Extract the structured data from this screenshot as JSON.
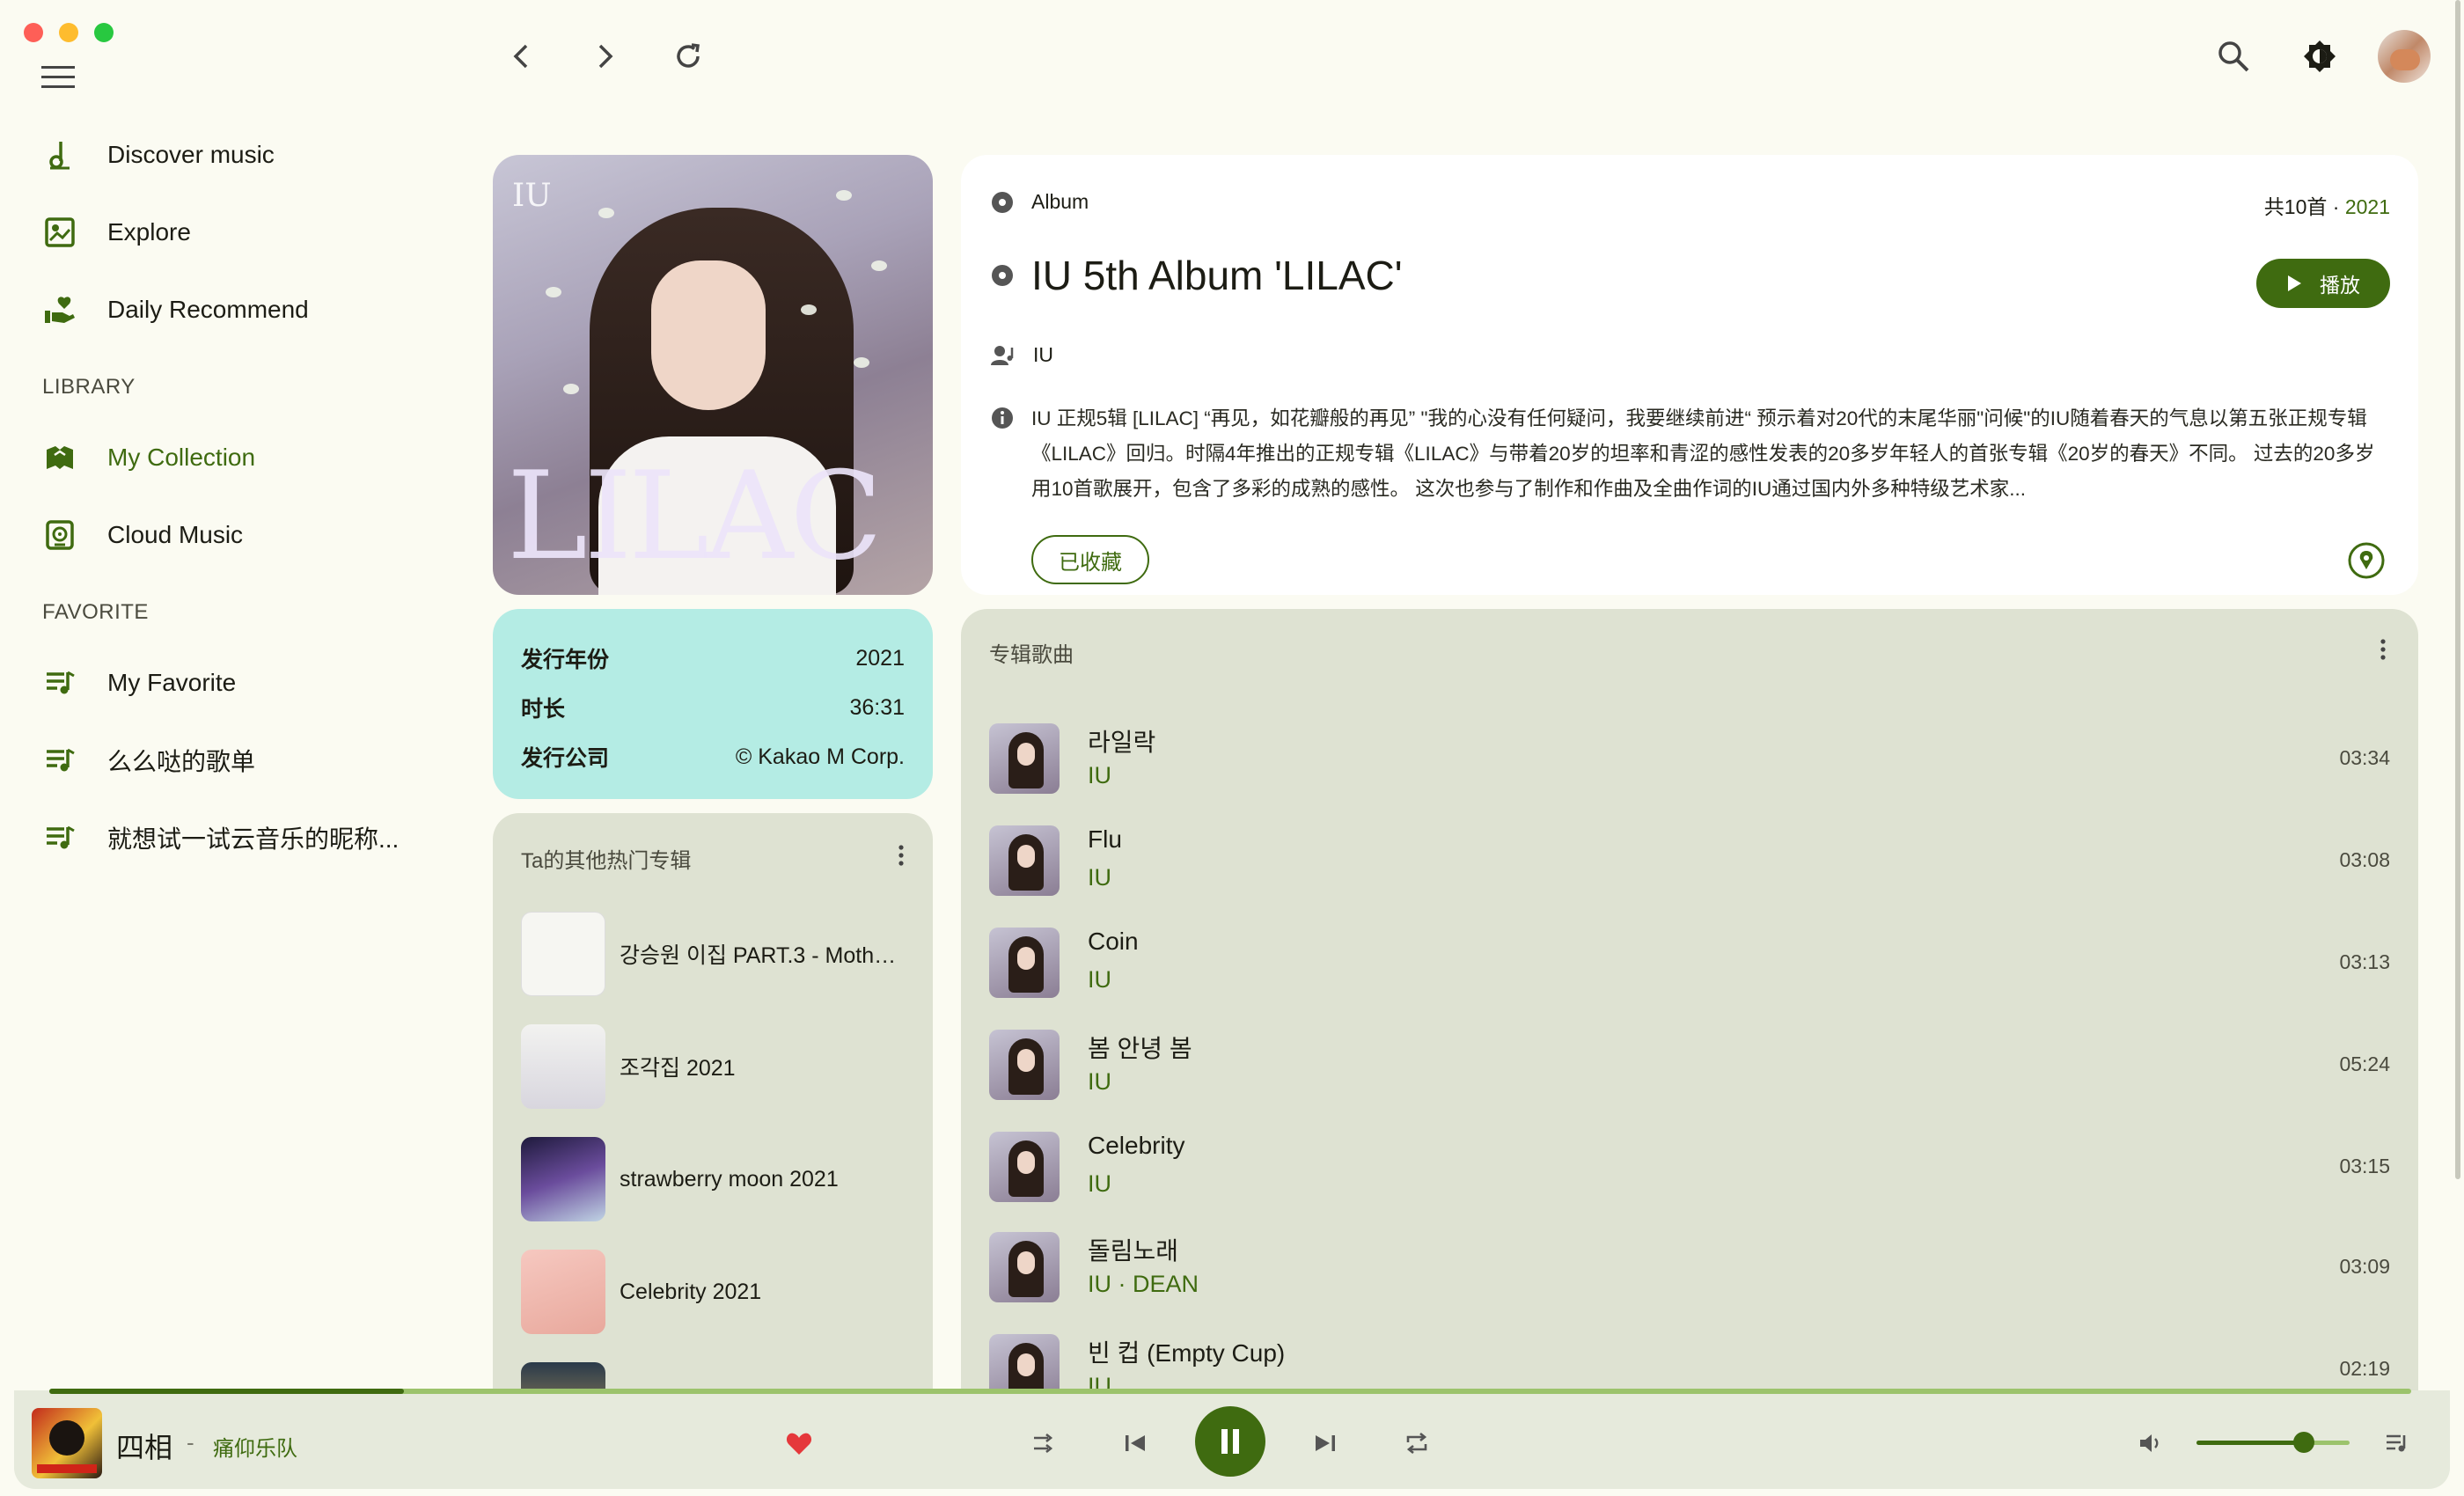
{
  "window": {
    "controls": [
      "close",
      "minimize",
      "maximize"
    ]
  },
  "topbar": {
    "menu_icon": "hamburger-menu-icon",
    "back_icon": "chevron-left-icon",
    "forward_icon": "chevron-right-icon",
    "refresh_icon": "refresh-icon",
    "search_icon": "search-icon",
    "theme_icon": "brightness-icon",
    "avatar": "user-avatar"
  },
  "sidebar": {
    "items": [
      {
        "label": "Discover music",
        "icon": "music-note-icon"
      },
      {
        "label": "Explore",
        "icon": "explore-icon"
      },
      {
        "label": "Daily Recommend",
        "icon": "hand-heart-icon"
      }
    ],
    "library_title": "LIBRARY",
    "library": [
      {
        "label": "My Collection",
        "icon": "collection-icon",
        "active": true
      },
      {
        "label": "Cloud Music",
        "icon": "cloud-music-icon"
      }
    ],
    "favorite_title": "FAVORITE",
    "favorite": [
      {
        "label": "My Favorite",
        "icon": "playlist-icon"
      },
      {
        "label": "么么哒的歌单",
        "icon": "playlist-icon"
      },
      {
        "label": "就想试一试云音乐的昵称...",
        "icon": "playlist-icon"
      }
    ]
  },
  "album": {
    "type_label": "Album",
    "count": "共10首",
    "year": "2021",
    "title": "IU 5th Album 'LILAC'",
    "artist": "IU",
    "description": "IU 正规5辑 [LILAC] “再见，如花瓣般的再见” \"我的心没有任何疑问，我要继续前进“ 预示着对20代的末尾华丽\"问候\"的IU随着春天的气息以第五张正规专辑《LILAC》回归。时隔4年推出的正规专辑《LILAC》与带着20岁的坦率和青涩的感性发表的20多岁年轻人的首张专辑《20岁的春天》不同。 过去的20多岁用10首歌展开，包含了多彩的成熟的感性。 这次也参与了制作和作曲及全曲作词的IU通过国内外多种特级艺术家...",
    "play_label": "播放",
    "collected_label": "已收藏",
    "cover_text": {
      "small": "IU",
      "big": "LILAC"
    }
  },
  "info": {
    "rows": [
      {
        "key": "发行年份",
        "value": "2021"
      },
      {
        "key": "时长",
        "value": "36:31"
      },
      {
        "key": "发行公司",
        "value": "© Kakao M Corp."
      }
    ]
  },
  "other_albums": {
    "title": "Ta的其他热门专辑",
    "items": [
      {
        "name": "강승원 이집 PART.3 - Mother..."
      },
      {
        "name": "조각집 2021"
      },
      {
        "name": "strawberry moon 2021"
      },
      {
        "name": "Celebrity 2021"
      },
      {
        "name": ""
      }
    ]
  },
  "tracks": {
    "title": "专辑歌曲",
    "items": [
      {
        "name": "라일락",
        "artist": "IU",
        "duration": "03:34"
      },
      {
        "name": "Flu",
        "artist": "IU",
        "duration": "03:08"
      },
      {
        "name": "Coin",
        "artist": "IU",
        "duration": "03:13"
      },
      {
        "name": "봄 안녕 봄",
        "artist": "IU",
        "duration": "05:24"
      },
      {
        "name": "Celebrity",
        "artist": "IU",
        "duration": "03:15"
      },
      {
        "name": "돌림노래",
        "artist": "IU · DEAN",
        "duration": "03:09"
      },
      {
        "name": "빈 컵 (Empty Cup)",
        "artist": "IU",
        "duration": "02:19"
      }
    ]
  },
  "player": {
    "title": "四相",
    "separator": "-",
    "artist": "痛仰乐队",
    "liked": true,
    "progress": 0.15,
    "volume": 0.7
  },
  "colors": {
    "accent": "#3f6b10",
    "info_bg": "#b4ece4",
    "card_bg": "#dee2d2",
    "app_bg": "#fbfbf2"
  }
}
